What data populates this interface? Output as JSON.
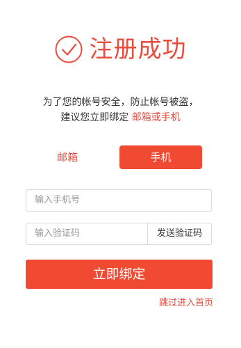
{
  "header": {
    "title": "注册成功",
    "icon": "check-circle-icon",
    "accent_color": "#e84c3d"
  },
  "notice": {
    "line1": "为了您的帐号安全，防止帐号被盗，",
    "line2_prefix": "建议您立即绑定",
    "line2_highlight": "邮箱或手机"
  },
  "tabs": {
    "email_label": "邮箱",
    "phone_label": "手机",
    "active": "手机"
  },
  "form": {
    "phone_placeholder": "输入手机号",
    "code_placeholder": "输入验证码",
    "send_code_label": "发送验证码"
  },
  "actions": {
    "submit_label": "立即绑定",
    "skip_label": "跳过进入首页",
    "button_color": "#f04a33"
  }
}
